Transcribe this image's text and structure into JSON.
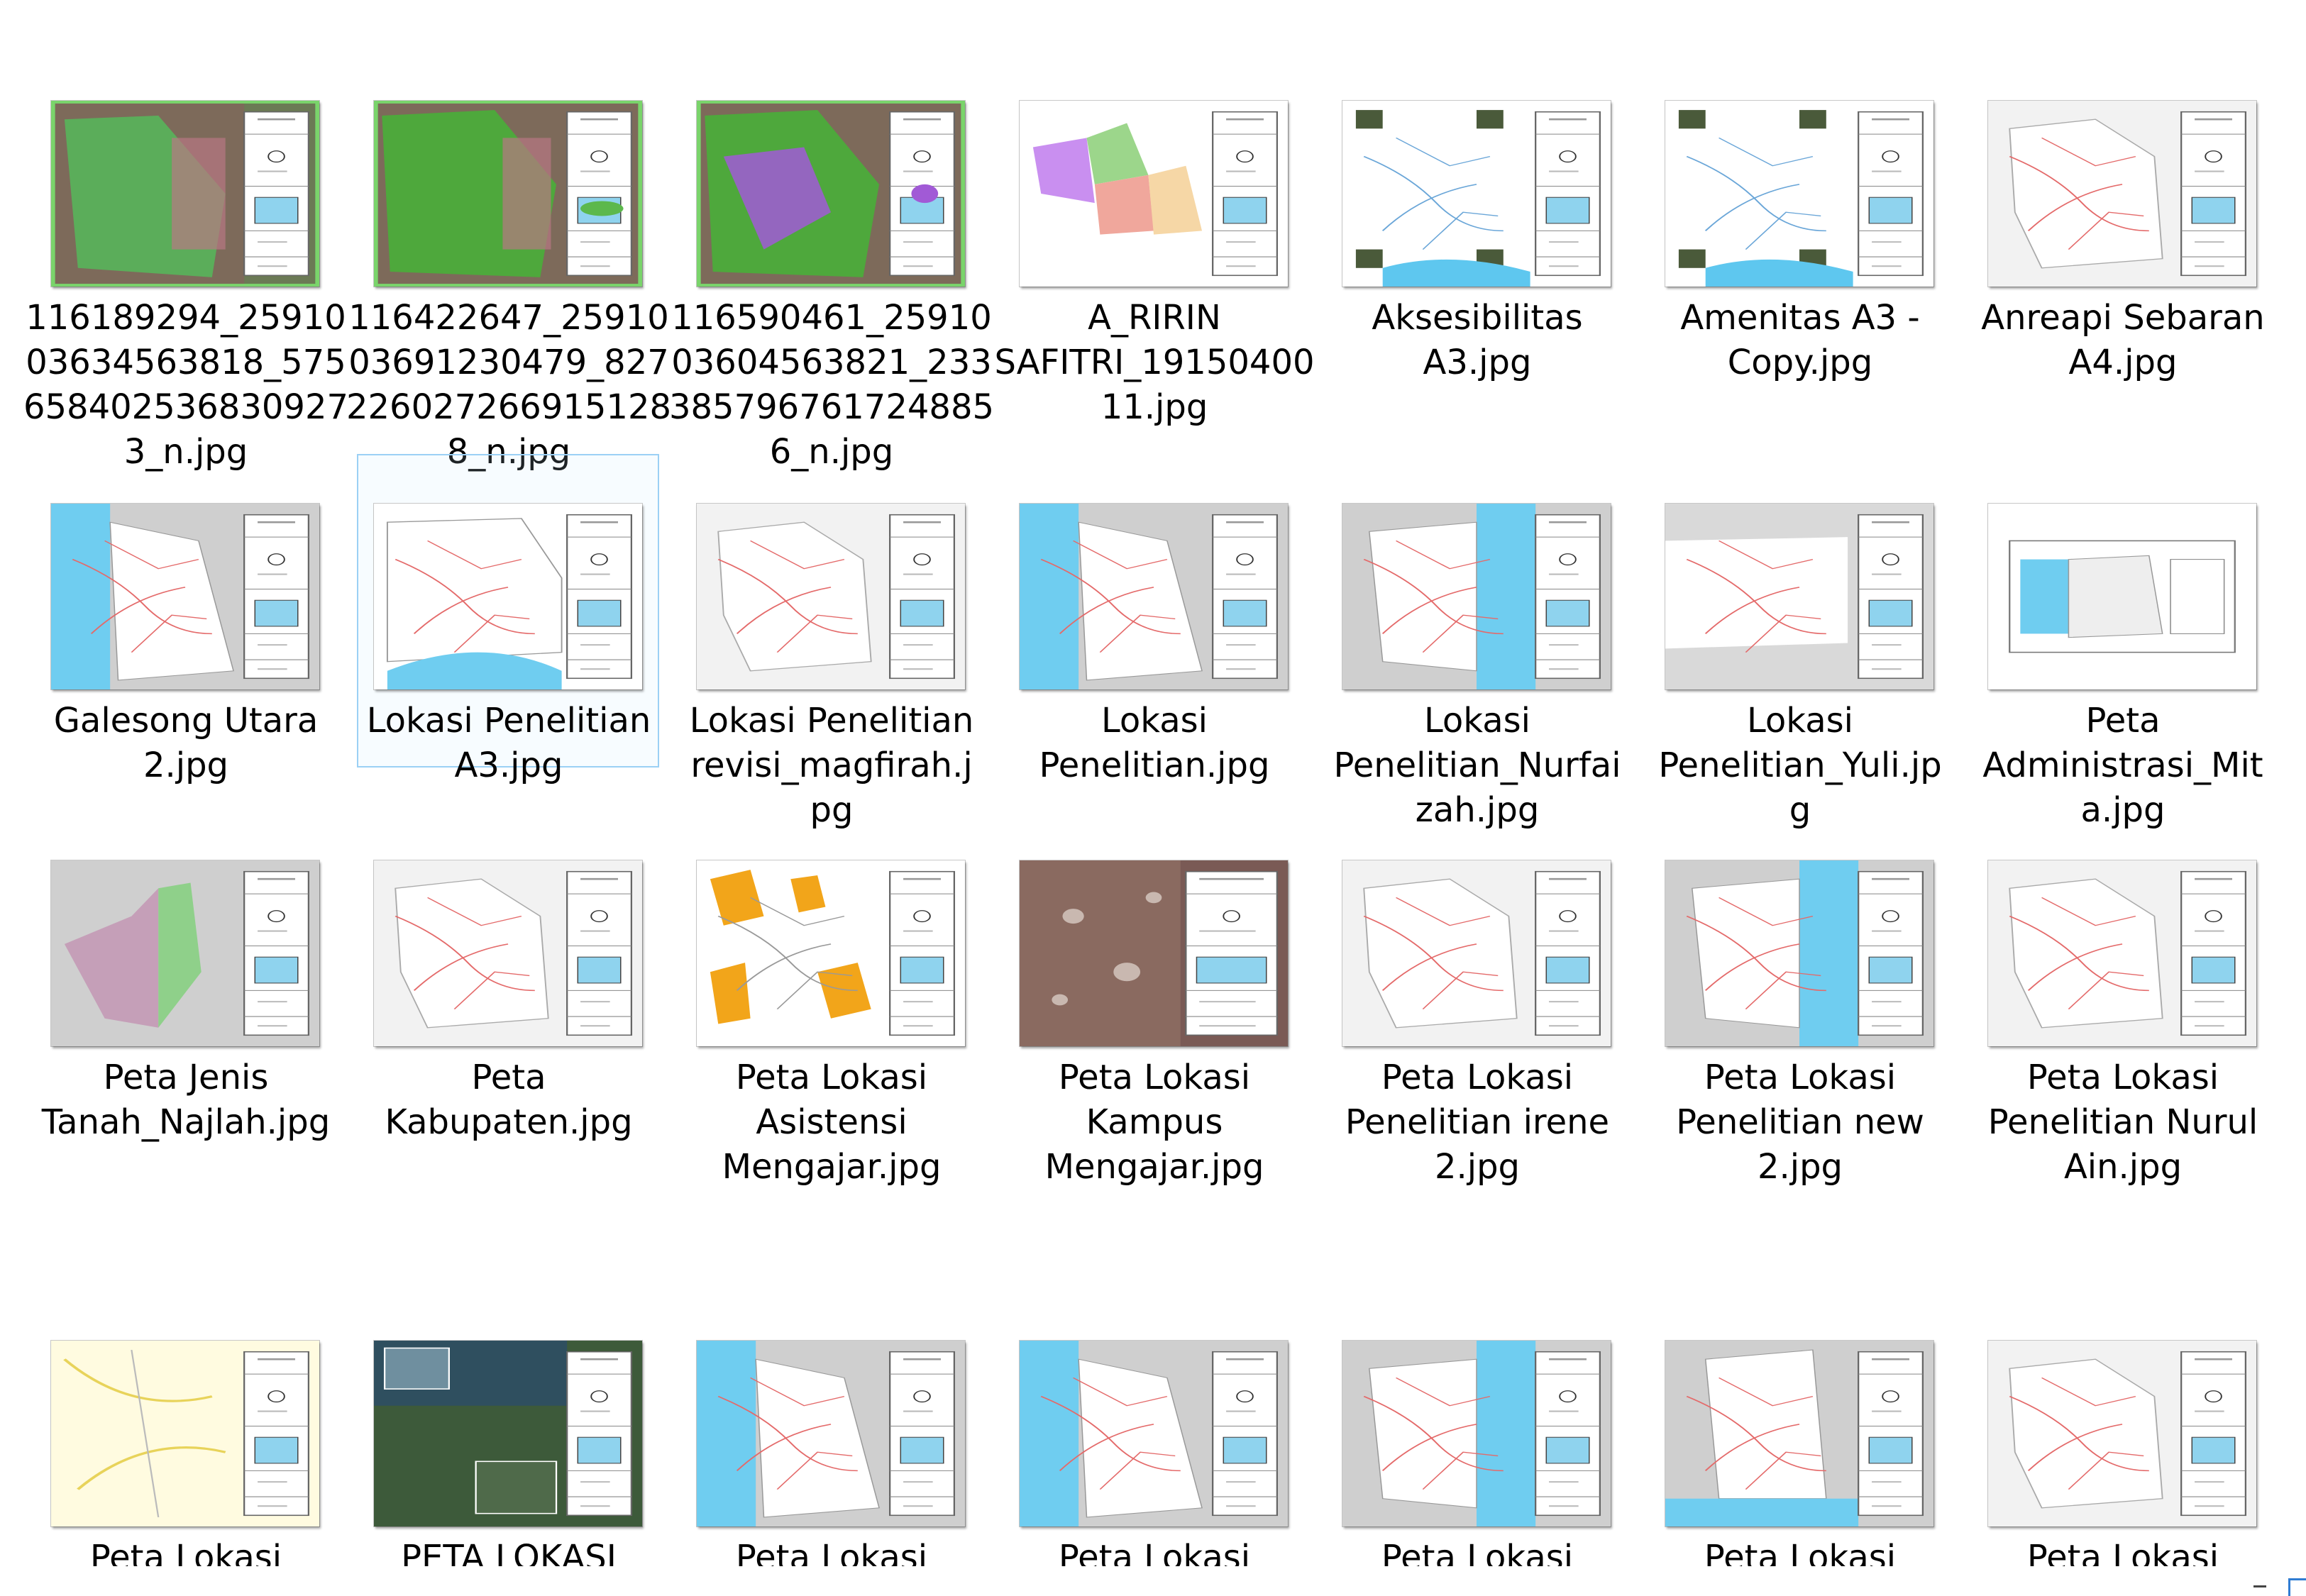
{
  "files": [
    {
      "lines": [
        "116189294_25910",
        "03634563818_575",
        "658402536830927",
        "3_n.jpg"
      ],
      "thumb": "green-satellite"
    },
    {
      "lines": [
        "116422647_25910",
        "03691230479_827",
        "226027266915128",
        "8_n.jpg"
      ],
      "thumb": "green-satellite-2"
    },
    {
      "lines": [
        "116590461_25910",
        "03604563821_233",
        "385796761724885",
        "6_n.jpg"
      ],
      "thumb": "purple-satellite"
    },
    {
      "lines": [
        "A_RIRIN",
        "SAFITRI_19150400",
        "11.jpg"
      ],
      "thumb": "colored-regions"
    },
    {
      "lines": [
        "Aksesibilitas",
        "A3.jpg"
      ],
      "thumb": "photo-map"
    },
    {
      "lines": [
        "Amenitas A3 -",
        "Copy.jpg"
      ],
      "thumb": "photo-map"
    },
    {
      "lines": [
        "Anreapi Sebaran",
        "A4.jpg"
      ],
      "thumb": "white-map"
    },
    {
      "lines": [
        "Galesong Utara",
        "2.jpg"
      ],
      "thumb": "coast-left"
    },
    {
      "lines": [
        "Lokasi Penelitian",
        "A3.jpg"
      ],
      "thumb": "white-map-sea",
      "selected": true
    },
    {
      "lines": [
        "Lokasi Penelitian",
        "revisi_magfirah.j",
        "pg"
      ],
      "thumb": "white-map"
    },
    {
      "lines": [
        "Lokasi",
        "Penelitian.jpg"
      ],
      "thumb": "coast-left"
    },
    {
      "lines": [
        "Lokasi",
        "Penelitian_Nurfai",
        "zah.jpg"
      ],
      "thumb": "coast-right"
    },
    {
      "lines": [
        "Lokasi",
        "Penelitian_Yuli.jp",
        "g"
      ],
      "thumb": "wide-white"
    },
    {
      "lines": [
        "Peta",
        "Administrasi_Mit",
        "a.jpg"
      ],
      "thumb": "small-map"
    },
    {
      "lines": [
        "Peta Jenis",
        "Tanah_Najlah.jpg"
      ],
      "thumb": "pink-green"
    },
    {
      "lines": [
        "Peta",
        "Kabupaten.jpg"
      ],
      "thumb": "white-map"
    },
    {
      "lines": [
        "Peta Lokasi",
        "Asistensi",
        "Mengajar.jpg"
      ],
      "thumb": "orange-map"
    },
    {
      "lines": [
        "Peta Lokasi",
        "Kampus",
        "Mengajar.jpg"
      ],
      "thumb": "urban-photo"
    },
    {
      "lines": [
        "Peta Lokasi",
        "Penelitian irene",
        "2.jpg"
      ],
      "thumb": "white-map"
    },
    {
      "lines": [
        "Peta Lokasi",
        "Penelitian new",
        "2.jpg"
      ],
      "thumb": "coast-right"
    },
    {
      "lines": [
        "Peta Lokasi",
        "Penelitian Nurul",
        "Ain.jpg"
      ],
      "thumb": "white-map"
    },
    {
      "lines": [
        "Peta Lokasi"
      ],
      "thumb": "yellow-roads"
    },
    {
      "lines": [
        "PETA LOKASI"
      ],
      "thumb": "dark-satellite"
    },
    {
      "lines": [
        "Peta Lokasi"
      ],
      "thumb": "coast-left"
    },
    {
      "lines": [
        "Peta Lokasi"
      ],
      "thumb": "coast-left"
    },
    {
      "lines": [
        "Peta Lokasi"
      ],
      "thumb": "coast-right"
    },
    {
      "lines": [
        "Peta Lokasi"
      ],
      "thumb": "sea-bottom"
    },
    {
      "lines": [
        "Peta Lokasi"
      ],
      "thumb": "white-map"
    }
  ]
}
